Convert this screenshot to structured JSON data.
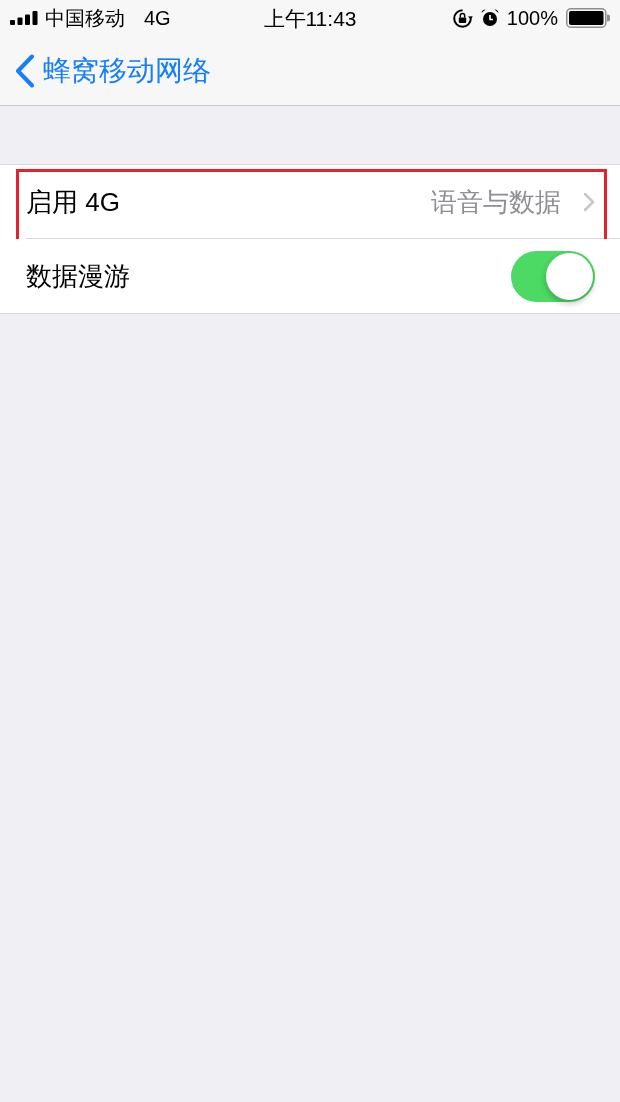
{
  "status_bar": {
    "carrier": "中国移动",
    "network": "4G",
    "time": "上午11:43",
    "battery": "100%"
  },
  "nav": {
    "back_label": "蜂窝移动网络"
  },
  "rows": [
    {
      "kind": "disclosure",
      "label": "启用 4G",
      "value": "语音与数据",
      "highlighted": true
    },
    {
      "kind": "switch",
      "label": "数据漫游",
      "on": true,
      "highlighted": false
    }
  ]
}
